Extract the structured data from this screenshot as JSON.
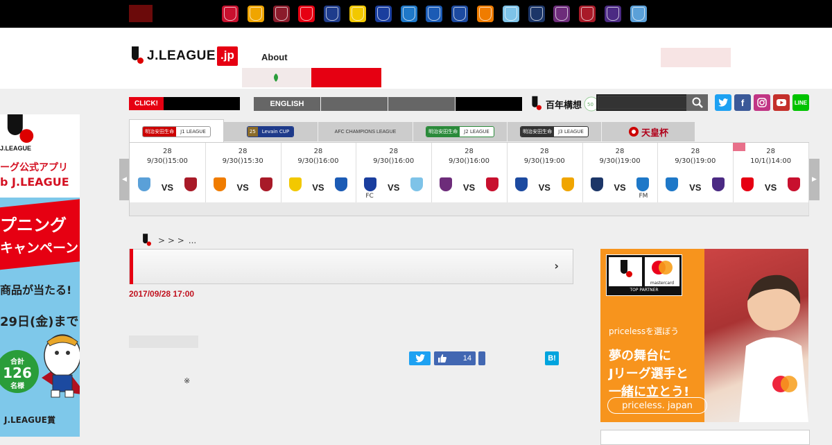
{
  "topbar": {
    "tabs": [
      "",
      "",
      ""
    ],
    "club_colors": [
      "#c8102e",
      "#f0a500",
      "#8b1b2b",
      "#e60012",
      "#1e3c8c",
      "#f2c800",
      "#1a3e9e",
      "#1e78c8",
      "#1b5bb5",
      "#1c4aa0",
      "#f07c00",
      "#7ec3e8",
      "#1c3668",
      "#6d2c7a",
      "#a81a28",
      "#4b2a83",
      "#5aa0d8"
    ]
  },
  "header": {
    "logo_text": "J.LEAGUE",
    "logo_suffix": ".jp",
    "about": "About",
    "header_button": "",
    "sub_menu": "",
    "sub_red": ""
  },
  "nav": {
    "click_label": "CLICK!",
    "click_text": "",
    "english": "ENGLISH",
    "btn2": "",
    "btn3": "",
    "btn4": "",
    "hyakunen": "百年構想",
    "search_placeholder": "",
    "social": [
      "twitter",
      "facebook",
      "instagram",
      "youtube",
      "line"
    ]
  },
  "left_ad": {
    "brand": "J.LEAGUE",
    "line1": "ーグ公式アプリ",
    "line2": "b J.LEAGUE",
    "banner1": "プニング",
    "banner2": "キャンペーン",
    "text1": "商品が当たる!",
    "date": "29日(金)まで",
    "total_label": "合計",
    "total_num": "126",
    "total_unit": "名様",
    "award": "J.LEAGUE賞"
  },
  "league_tabs": [
    {
      "name": "J1 LEAGUE",
      "sponsor": "明治安田生命"
    },
    {
      "name": "Levain CUP",
      "sponsor": "25"
    },
    {
      "name": "AFC CHAMPIONS LEAGUE",
      "sponsor": ""
    },
    {
      "name": "J2 LEAGUE",
      "sponsor": "明治安田生命"
    },
    {
      "name": "J3 LEAGUE",
      "sponsor": "明治安田生命"
    },
    {
      "name": "天皇杯",
      "sponsor": ""
    }
  ],
  "fixtures": [
    {
      "round": "28",
      "datetime": "9/30()15:00",
      "vs": "VS",
      "home_color": "#5aa0d8",
      "away_color": "#a81a28",
      "note_home": "",
      "note_away": ""
    },
    {
      "round": "28",
      "datetime": "9/30()15:30",
      "vs": "VS",
      "home_color": "#f07c00",
      "away_color": "#a81a28",
      "note_home": "",
      "note_away": ""
    },
    {
      "round": "28",
      "datetime": "9/30()16:00",
      "vs": "VS",
      "home_color": "#f2c800",
      "away_color": "#1b5bb5",
      "note_home": "",
      "note_away": ""
    },
    {
      "round": "28",
      "datetime": "9/30()16:00",
      "vs": "VS",
      "home_color": "#1a3e9e",
      "away_color": "#7ec3e8",
      "note_home": "FC",
      "note_away": ""
    },
    {
      "round": "28",
      "datetime": "9/30()16:00",
      "vs": "VS",
      "home_color": "#6d2c7a",
      "away_color": "#c8102e",
      "note_home": "",
      "note_away": ""
    },
    {
      "round": "28",
      "datetime": "9/30()19:00",
      "vs": "VS",
      "home_color": "#1c4aa0",
      "away_color": "#f0a500",
      "note_home": "",
      "note_away": ""
    },
    {
      "round": "28",
      "datetime": "9/30()19:00",
      "vs": "VS",
      "home_color": "#1c3668",
      "away_color": "#1e78c8",
      "note_home": "",
      "note_away": "FM"
    },
    {
      "round": "28",
      "datetime": "9/30()19:00",
      "vs": "VS",
      "home_color": "#1e78c8",
      "away_color": "#4b2a83",
      "note_home": "",
      "note_away": ""
    },
    {
      "round": "28",
      "datetime": "10/1()14:00",
      "vs": "VS",
      "home_color": "#e60012",
      "away_color": "#c8102e",
      "note_home": "",
      "note_away": ""
    }
  ],
  "breadcrumb": {
    "sep": "> > >",
    "tail": "..."
  },
  "article": {
    "date": "2017/09/28 17:00",
    "note": "※",
    "like_count": "14"
  },
  "right_ad": {
    "partner": "TOP PARTNER",
    "mc": "mastercard",
    "line1": "pricelessを選ぼう",
    "line2": "夢の舞台に",
    "line3": "Jリーグ選手と",
    "line4": "一緒に立とう!",
    "tag": "priceless. japan"
  }
}
